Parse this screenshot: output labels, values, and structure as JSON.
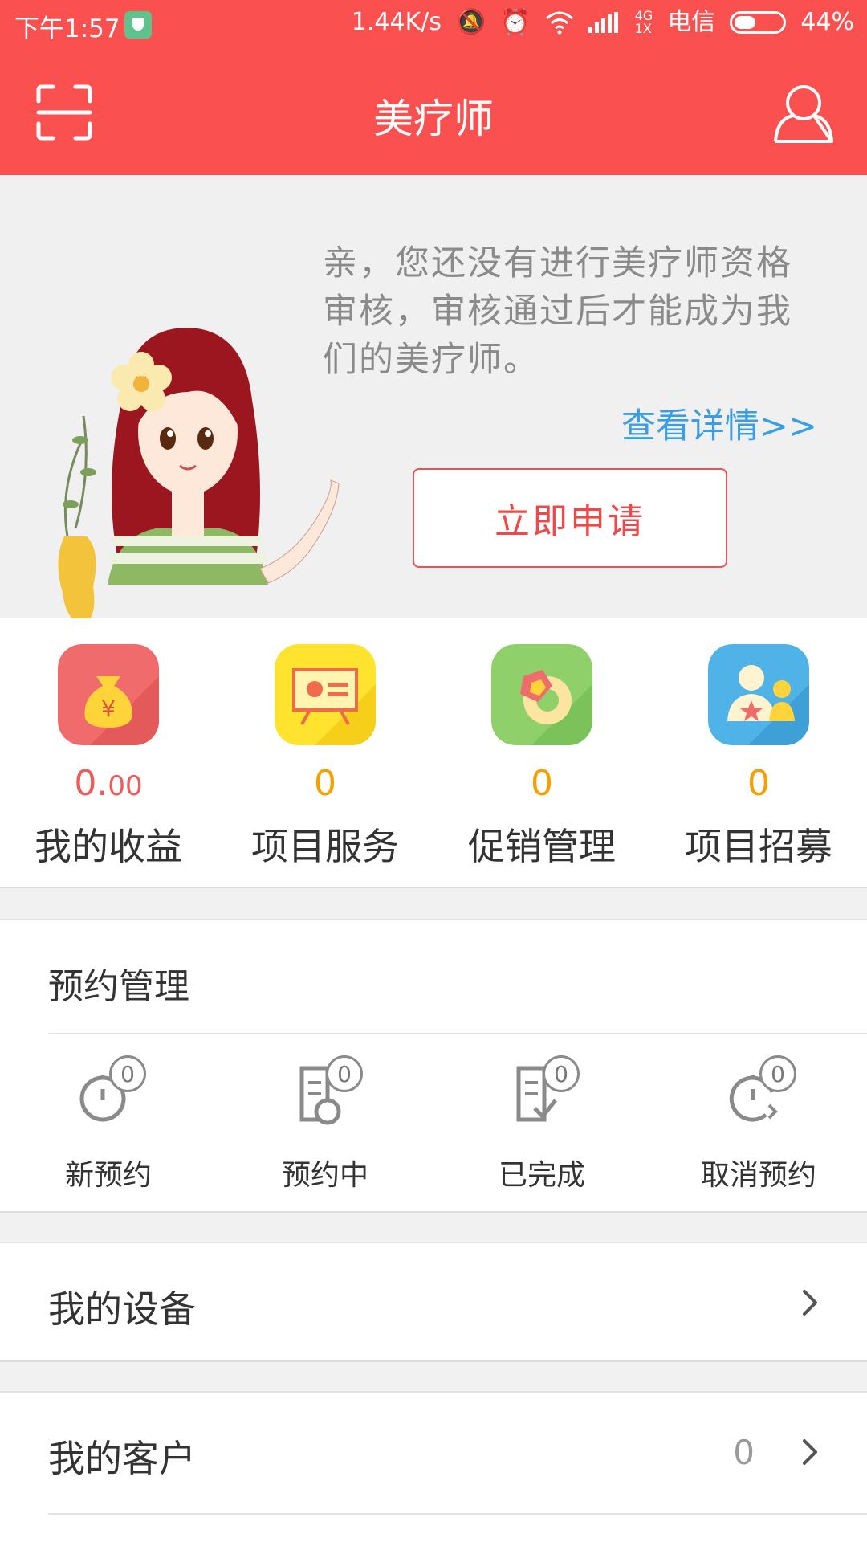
{
  "status_bar": {
    "time": "下午1:57",
    "speed": "1.44K/s",
    "network_type": "4G\n1X",
    "carrier": "电信",
    "battery": "44%"
  },
  "app_bar": {
    "title": "美疗师"
  },
  "banner": {
    "message": "亲，您还没有进行美疗师资格审核，审核通过后才能成为我们的美疗师。",
    "detail_link": "查看详情>>",
    "apply_button": "立即申请"
  },
  "stats": [
    {
      "value_int": "0.",
      "value_dec": "00",
      "label": "我的收益",
      "color": "#f05a5a"
    },
    {
      "value": "0",
      "label": "项目服务",
      "color": "#f3a000"
    },
    {
      "value": "0",
      "label": "促销管理",
      "color": "#f3a000"
    },
    {
      "value": "0",
      "label": "项目招募",
      "color": "#f3a000"
    }
  ],
  "appointments": {
    "title": "预约管理",
    "items": [
      {
        "label": "新预约",
        "count": "0"
      },
      {
        "label": "预约中",
        "count": "0"
      },
      {
        "label": "已完成",
        "count": "0"
      },
      {
        "label": "取消预约",
        "count": "0"
      }
    ]
  },
  "rows": {
    "devices": {
      "label": "我的设备"
    },
    "clients": {
      "label": "我的客户",
      "count": "0"
    }
  },
  "colors": {
    "brand": "#fa5050",
    "link": "#3a9ee4",
    "value": "#f3a000"
  }
}
